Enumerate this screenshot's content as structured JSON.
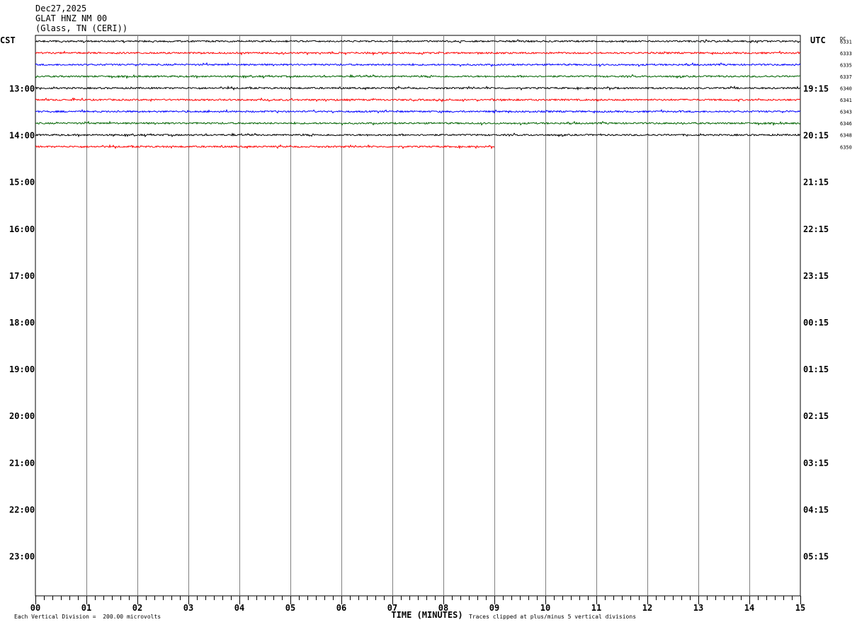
{
  "header": {
    "date": "Dec27,2025",
    "station": "GLAT HNZ NM 00",
    "location": "(Glass, TN (CERI))"
  },
  "chart_data": {
    "type": "line",
    "left_timezone": "CST",
    "right_timezone": "UTC",
    "dc_label": "DC",
    "xlabel": "TIME (MINUTES)",
    "x_ticks": [
      "00",
      "01",
      "02",
      "03",
      "04",
      "05",
      "06",
      "07",
      "08",
      "09",
      "10",
      "11",
      "12",
      "13",
      "14",
      "15"
    ],
    "xlim": [
      0,
      15
    ],
    "left_hour_labels": [
      "13:00",
      "14:00",
      "15:00",
      "16:00",
      "17:00",
      "18:00",
      "19:00",
      "20:00",
      "21:00",
      "22:00",
      "23:00"
    ],
    "right_hour_labels": [
      "19:15",
      "20:15",
      "21:15",
      "22:15",
      "23:15",
      "00:15",
      "01:15",
      "02:15",
      "03:15",
      "04:15",
      "05:15"
    ],
    "traces": [
      {
        "dc": "6331",
        "color": "#000000",
        "end_minute": 15
      },
      {
        "dc": "6333",
        "color": "#ff0000",
        "end_minute": 15
      },
      {
        "dc": "6335",
        "color": "#0000ff",
        "end_minute": 15
      },
      {
        "dc": "6337",
        "color": "#006400",
        "end_minute": 15
      },
      {
        "dc": "6340",
        "color": "#000000",
        "end_minute": 15
      },
      {
        "dc": "6341",
        "color": "#ff0000",
        "end_minute": 15
      },
      {
        "dc": "6343",
        "color": "#0000ff",
        "end_minute": 15
      },
      {
        "dc": "6346",
        "color": "#006400",
        "end_minute": 15
      },
      {
        "dc": "6348",
        "color": "#000000",
        "end_minute": 15
      },
      {
        "dc": "6350",
        "color": "#ff0000",
        "end_minute": 9
      }
    ],
    "footnote_left": "Each Vertical Division =  200.00 microvolts",
    "footnote_right": "Traces clipped at plus/minus 5 vertical divisions",
    "grid": true
  }
}
